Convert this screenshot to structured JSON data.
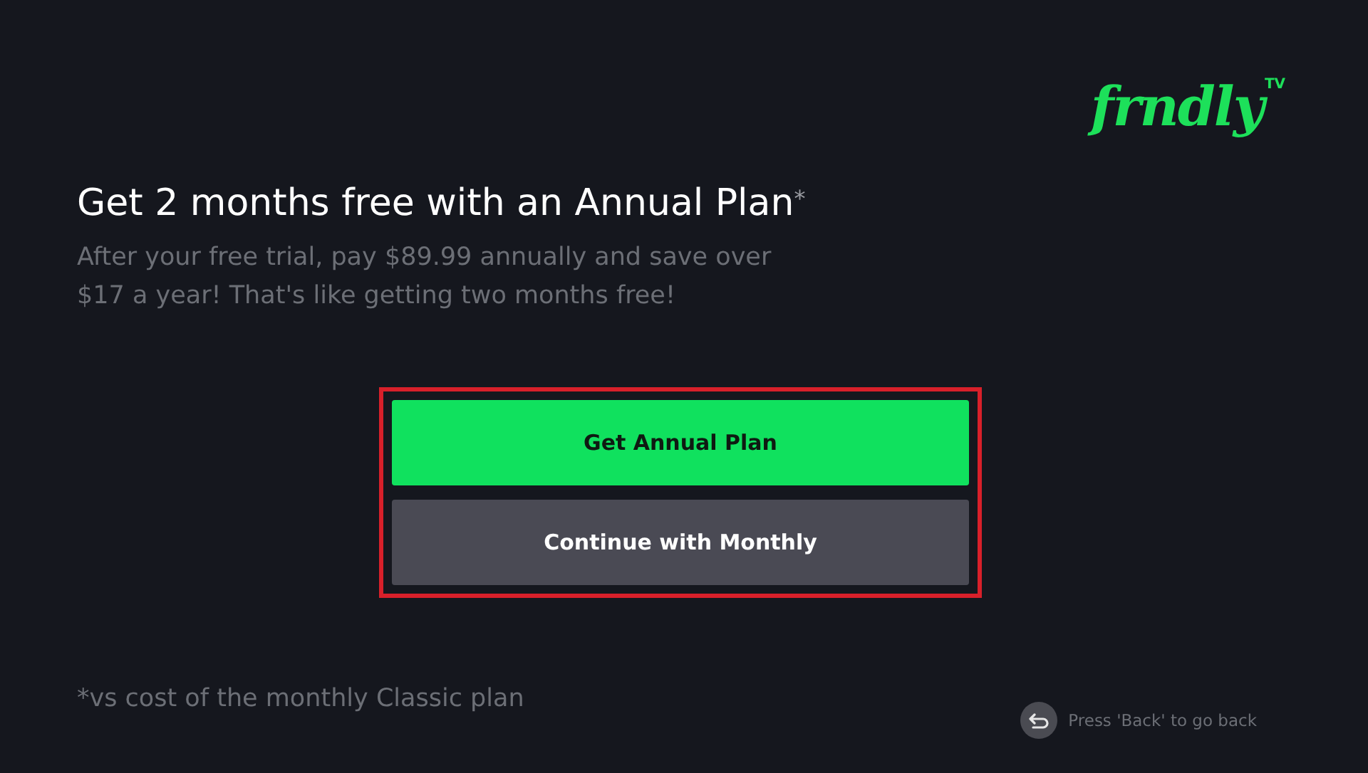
{
  "logo": {
    "name": "frndly",
    "badge": "TV"
  },
  "title": "Get 2 months free with an Annual Plan$^{*}$",
  "description": "After your free trial, pay $89.99 annually and save over $17 a year! That's like getting two months free!",
  "buttons": [
    {
      "label": "Get Annual Plan",
      "kind": "primary"
    },
    {
      "label": "Continue with Monthly",
      "kind": "secondary"
    }
  ],
  "buttons_highlighted": true,
  "footnote": "*vs cost of the monthly Classic plan",
  "back_hint": "Press 'Back' to go back"
}
